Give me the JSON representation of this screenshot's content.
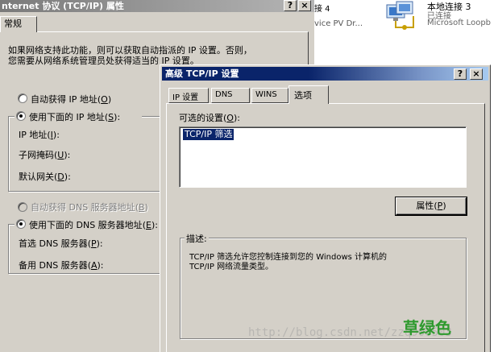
{
  "background_window": {
    "item1_name_fragment": "接 4",
    "item1_detail_fragment": "vice PV Dr...",
    "item2_name": "本地连接 3",
    "item2_status": "已连接",
    "item2_detail": "Microsoft Loopb"
  },
  "props_dialog": {
    "title": "nternet 协议 (TCP/IP) 属性",
    "help_button": "?",
    "close_button": "×",
    "tab_general": "常规",
    "intro_line1": "如果网络支持此功能，则可以获取自动指派的 IP 设置。否则，",
    "intro_line2": "您需要从网络系统管理员处获得适当的 IP 设置。",
    "radio_auto_ip": {
      "label": "自动获得 IP 地址",
      "key": "O",
      "selected": false
    },
    "radio_manual_ip": {
      "label": "使用下面的 IP 地址",
      "key": "S",
      "selected": true
    },
    "ip_address": {
      "label": "IP 地址",
      "key": "I"
    },
    "subnet_mask": {
      "label": "子网掩码",
      "key": "U"
    },
    "default_gateway": {
      "label": "默认网关",
      "key": "D"
    },
    "radio_auto_dns": {
      "label": "自动获得 DNS 服务器地址",
      "key": "B",
      "selected": false,
      "disabled": true
    },
    "radio_manual_dns": {
      "label": "使用下面的 DNS 服务器地址",
      "key": "E",
      "selected": true
    },
    "preferred_dns": {
      "label": "首选 DNS 服务器",
      "key": "P"
    },
    "alternate_dns": {
      "label": "备用 DNS 服务器",
      "key": "A"
    }
  },
  "advanced_dialog": {
    "title": "高级 TCP/IP 设置",
    "help_button": "?",
    "close_button": "×",
    "tabs": [
      "IP 设置",
      "DNS",
      "WINS",
      "选项"
    ],
    "active_tab": "选项",
    "optional_settings_label": "可选的设置",
    "optional_settings_key": "O",
    "optional_settings_items": [
      "TCP/IP 筛选"
    ],
    "properties_button": "属性",
    "properties_key": "P",
    "description_group_label": "描述:",
    "description_line1": "TCP/IP 筛选允许您控制连接到您的 Windows 计算机的",
    "description_line2": "TCP/IP 网络流量类型。"
  },
  "overlay": {
    "watermark": "http://blog.csdn.net/zzq900503",
    "annotation": "草绿色",
    "annotation_color": "#2e9a2e"
  }
}
